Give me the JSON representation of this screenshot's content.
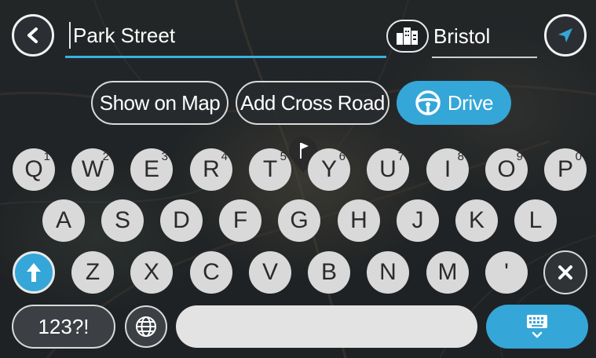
{
  "search": {
    "value": "Park Street"
  },
  "city": {
    "value": "Bristol"
  },
  "actions": {
    "show_on_map": "Show on Map",
    "add_cross_road": "Add Cross Road",
    "drive": "Drive"
  },
  "keyboard": {
    "row1": [
      {
        "label": "Q",
        "sup": "1"
      },
      {
        "label": "W",
        "sup": "2"
      },
      {
        "label": "E",
        "sup": "3"
      },
      {
        "label": "R",
        "sup": "4"
      },
      {
        "label": "T",
        "sup": "5"
      },
      {
        "label": "Y",
        "sup": "6"
      },
      {
        "label": "U",
        "sup": "7"
      },
      {
        "label": "I",
        "sup": "8"
      },
      {
        "label": "O",
        "sup": "9"
      },
      {
        "label": "P",
        "sup": "0"
      }
    ],
    "row2": [
      "A",
      "S",
      "D",
      "F",
      "G",
      "H",
      "J",
      "K",
      "L"
    ],
    "row3": [
      "Z",
      "X",
      "C",
      "V",
      "B",
      "N",
      "M",
      "'"
    ],
    "numbers_label": "123?!"
  },
  "icons": {
    "back": "back-arrow-icon",
    "city": "city-buildings-icon",
    "locate": "location-arrow-icon",
    "drive": "steering-wheel-icon",
    "shift": "shift-arrow-icon",
    "backspace": "backspace-x-icon",
    "globe": "globe-icon",
    "keyboard": "keyboard-hide-icon",
    "map_pin": "map-flag-pin-icon"
  },
  "colors": {
    "accent": "#35a6d8",
    "key": "#d9d9d9",
    "background": "#1f2326"
  }
}
